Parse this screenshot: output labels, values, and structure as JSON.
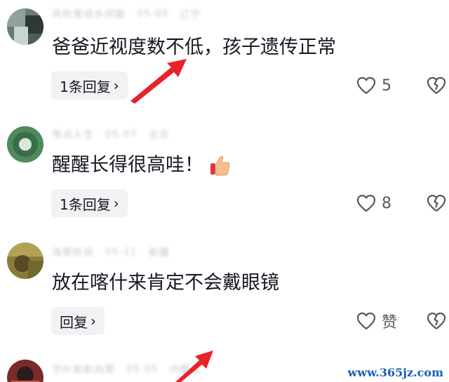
{
  "comments": [
    {
      "author": "风吹麦浪乡间路",
      "date": "05-05",
      "location": "辽宁",
      "text": "爸爸近视度数不低，孩子遗传正常",
      "reply_label": "1条回复",
      "likes": "5"
    },
    {
      "author": "带点人生",
      "date": "05-07",
      "location": "北京",
      "text": "醒醒长得很高哇！",
      "reply_label": "1条回复",
      "likes": "8"
    },
    {
      "author": "海景听风",
      "date": "05-11",
      "location": "新疆",
      "text": "放在喀什来肯定不会戴眼镜",
      "reply_label": "回复",
      "likes": "赞"
    },
    {
      "author": "华叶新新向荣",
      "date": "05-05",
      "location": "内蒙古"
    }
  ],
  "icons": {
    "chevron": "›",
    "like": "heart-outline-icon",
    "dislike": "broken-heart-icon",
    "thumbs": "thumbs-up-emoji-icon"
  },
  "watermark": "www.365jz.com",
  "colors": {
    "annotation_arrow": "#e8232a",
    "watermark": "#1a5fb4",
    "reply_bg": "#f2f2f4"
  }
}
